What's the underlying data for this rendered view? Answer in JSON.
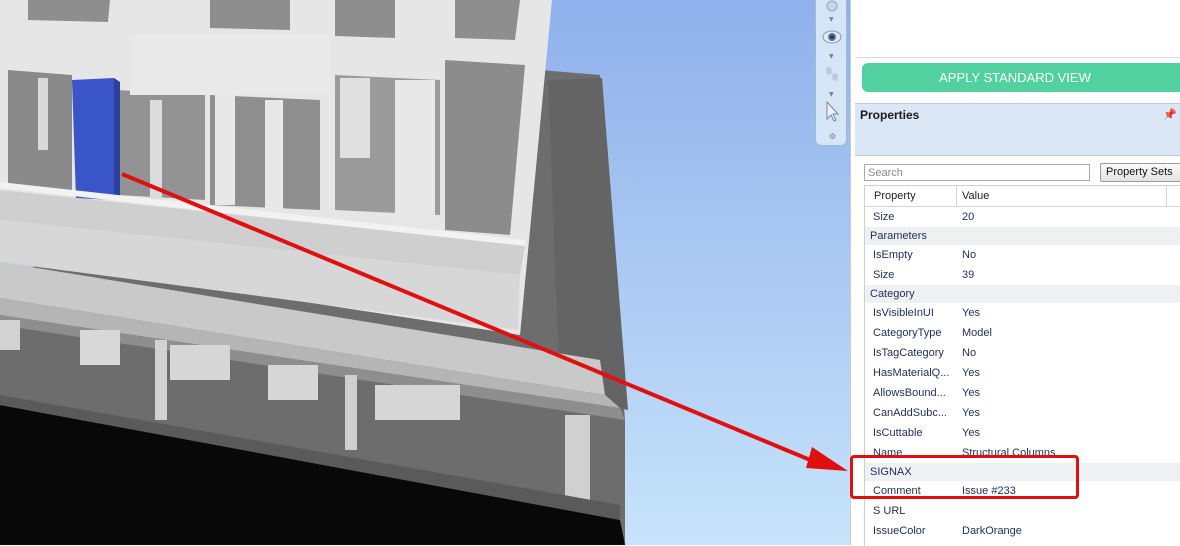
{
  "toolbar": {
    "apply_label": "APPLY STANDARD VIEW"
  },
  "nav_tools": [
    "orbit-icon",
    "look-around-icon",
    "walk-icon",
    "select-arrow-icon"
  ],
  "properties": {
    "title": "Properties",
    "search_placeholder": "Search",
    "property_sets_label": "Property Sets",
    "col_property": "Property",
    "col_value": "Value",
    "top_row": {
      "key": "Size",
      "value": "20"
    },
    "parameters": {
      "name": "Parameters",
      "rows": [
        {
          "key": "IsEmpty",
          "value": "No"
        },
        {
          "key": "Size",
          "value": "39"
        }
      ]
    },
    "category": {
      "name": "Category",
      "rows": [
        {
          "key": "IsVisibleInUI",
          "value": "Yes"
        },
        {
          "key": "CategoryType",
          "value": "Model"
        },
        {
          "key": "IsTagCategory",
          "value": "No"
        },
        {
          "key": "HasMaterialQ...",
          "value": "Yes"
        },
        {
          "key": "AllowsBound...",
          "value": "Yes"
        },
        {
          "key": "CanAddSubc...",
          "value": "Yes"
        },
        {
          "key": "IsCuttable",
          "value": "Yes"
        },
        {
          "key": "Name",
          "value": "Structural Columns"
        }
      ]
    },
    "signax": {
      "name": "SIGNAX",
      "rows": [
        {
          "key": "Comment",
          "value": "Issue #233"
        },
        {
          "key": "S URL",
          "value": ""
        },
        {
          "key": "IssueColor",
          "value": "DarkOrange"
        }
      ]
    }
  },
  "colors": {
    "accent_button": "#52d1a0",
    "selected_element": "#3a55c8",
    "annotation": "#e01010",
    "sky": "#9fc0ef"
  }
}
